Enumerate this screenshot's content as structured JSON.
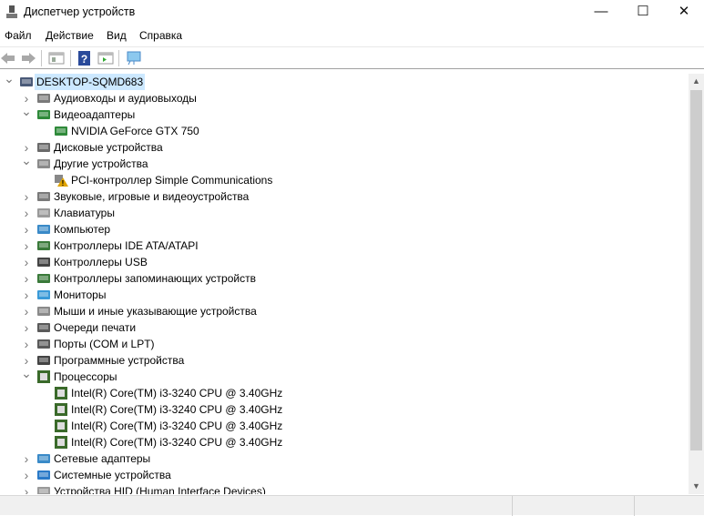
{
  "window": {
    "title": "Диспетчер устройств",
    "minimize": "—",
    "maximize": "☐",
    "close": "✕"
  },
  "menu": [
    "Файл",
    "Действие",
    "Вид",
    "Справка"
  ],
  "tree": [
    {
      "label": "DESKTOP-SQMD683",
      "level": 0,
      "state": "expanded",
      "icon": "computer-icon",
      "color": "#4a5a78",
      "selected": true
    },
    {
      "label": "Аудиовходы и аудиовыходы",
      "level": 1,
      "state": "collapsed",
      "icon": "speaker-icon",
      "color": "#7a7a7a"
    },
    {
      "label": "Видеоадаптеры",
      "level": 1,
      "state": "expanded",
      "icon": "display-adapter-icon",
      "color": "#2f8a3a"
    },
    {
      "label": "NVIDIA GeForce GTX 750",
      "level": 2,
      "state": "none",
      "icon": "display-adapter-icon",
      "color": "#2f8a3a"
    },
    {
      "label": "Дисковые устройства",
      "level": 1,
      "state": "collapsed",
      "icon": "disk-icon",
      "color": "#6a6a6a"
    },
    {
      "label": "Другие устройства",
      "level": 1,
      "state": "expanded",
      "icon": "unknown-device-icon",
      "color": "#8a8a8a"
    },
    {
      "label": "PCI-контроллер Simple Communications",
      "level": 2,
      "state": "none",
      "icon": "warning-device-icon",
      "color": "#e0a400"
    },
    {
      "label": "Звуковые, игровые и видеоустройства",
      "level": 1,
      "state": "collapsed",
      "icon": "speaker-icon",
      "color": "#7a7a7a"
    },
    {
      "label": "Клавиатуры",
      "level": 1,
      "state": "collapsed",
      "icon": "keyboard-icon",
      "color": "#9a9a9a"
    },
    {
      "label": "Компьютер",
      "level": 1,
      "state": "collapsed",
      "icon": "monitor-icon",
      "color": "#3a8ac8"
    },
    {
      "label": "Контроллеры IDE ATA/ATAPI",
      "level": 1,
      "state": "collapsed",
      "icon": "ide-controller-icon",
      "color": "#3a7a3a"
    },
    {
      "label": "Контроллеры USB",
      "level": 1,
      "state": "collapsed",
      "icon": "usb-icon",
      "color": "#444444"
    },
    {
      "label": "Контроллеры запоминающих устройств",
      "level": 1,
      "state": "collapsed",
      "icon": "storage-controller-icon",
      "color": "#3a7a3a"
    },
    {
      "label": "Мониторы",
      "level": 1,
      "state": "collapsed",
      "icon": "monitor-icon",
      "color": "#3a9ad8"
    },
    {
      "label": "Мыши и иные указывающие устройства",
      "level": 1,
      "state": "collapsed",
      "icon": "mouse-icon",
      "color": "#8a8a8a"
    },
    {
      "label": "Очереди печати",
      "level": 1,
      "state": "collapsed",
      "icon": "printer-icon",
      "color": "#5a5a5a"
    },
    {
      "label": "Порты (COM и LPT)",
      "level": 1,
      "state": "collapsed",
      "icon": "port-icon",
      "color": "#5a5a5a"
    },
    {
      "label": "Программные устройства",
      "level": 1,
      "state": "collapsed",
      "icon": "software-device-icon",
      "color": "#444444"
    },
    {
      "label": "Процессоры",
      "level": 1,
      "state": "expanded",
      "icon": "cpu-icon",
      "color": "#3a6a2a"
    },
    {
      "label": "Intel(R) Core(TM) i3-3240 CPU @ 3.40GHz",
      "level": 2,
      "state": "none",
      "icon": "cpu-icon",
      "color": "#3a6a2a"
    },
    {
      "label": "Intel(R) Core(TM) i3-3240 CPU @ 3.40GHz",
      "level": 2,
      "state": "none",
      "icon": "cpu-icon",
      "color": "#3a6a2a"
    },
    {
      "label": "Intel(R) Core(TM) i3-3240 CPU @ 3.40GHz",
      "level": 2,
      "state": "none",
      "icon": "cpu-icon",
      "color": "#3a6a2a"
    },
    {
      "label": "Intel(R) Core(TM) i3-3240 CPU @ 3.40GHz",
      "level": 2,
      "state": "none",
      "icon": "cpu-icon",
      "color": "#3a6a2a"
    },
    {
      "label": "Сетевые адаптеры",
      "level": 1,
      "state": "collapsed",
      "icon": "network-icon",
      "color": "#3a8ac8"
    },
    {
      "label": "Системные устройства",
      "level": 1,
      "state": "collapsed",
      "icon": "system-folder-icon",
      "color": "#2a7ac8"
    },
    {
      "label": "Устройства HID (Human Interface Devices)",
      "level": 1,
      "state": "collapsed",
      "icon": "hid-icon",
      "color": "#9a9a9a"
    }
  ]
}
